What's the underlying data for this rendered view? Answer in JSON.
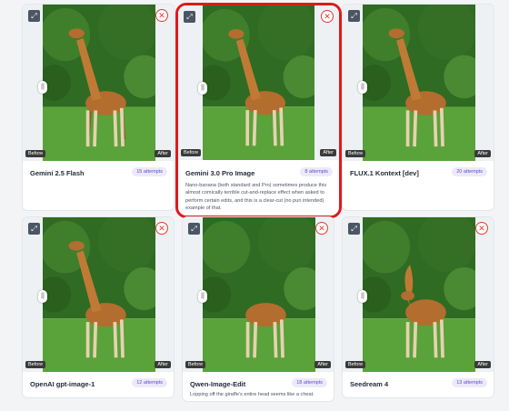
{
  "labels": {
    "before": "Before",
    "after": "After"
  },
  "icons": {
    "expand": "expand-icon",
    "remove": "close-circle-icon",
    "slider": "drag-handle-icon"
  },
  "colors": {
    "highlight": "#e11919",
    "attempts_text": "#5b4fc9",
    "attempts_bg": "#ede9fb",
    "remove": "#e53935"
  },
  "cards": [
    {
      "title": "Gemini 2.5 Flash",
      "attempts": "15 attempts",
      "description": ""
    },
    {
      "title": "Gemini 3.0 Pro Image",
      "attempts": "8 attempts",
      "description": "Nano-banana (both standard and Pro) sometimes produce this almost comically terrible cut-and-replace effect when asked to perform certain edits, and this is a clear-cut (no pun intended) example of that.",
      "highlighted": true
    },
    {
      "title": "FLUX.1 Kontext [dev]",
      "attempts": "20 attempts",
      "description": ""
    },
    {
      "title": "OpenAI gpt-image-1",
      "attempts": "12 attempts",
      "description": ""
    },
    {
      "title": "Qwen-Image-Edit",
      "attempts": "18 attempts",
      "description": "Lopping off the giraffe's entire head seems like a cheat."
    },
    {
      "title": "Seedream 4",
      "attempts": "13 attempts",
      "description": ""
    }
  ]
}
